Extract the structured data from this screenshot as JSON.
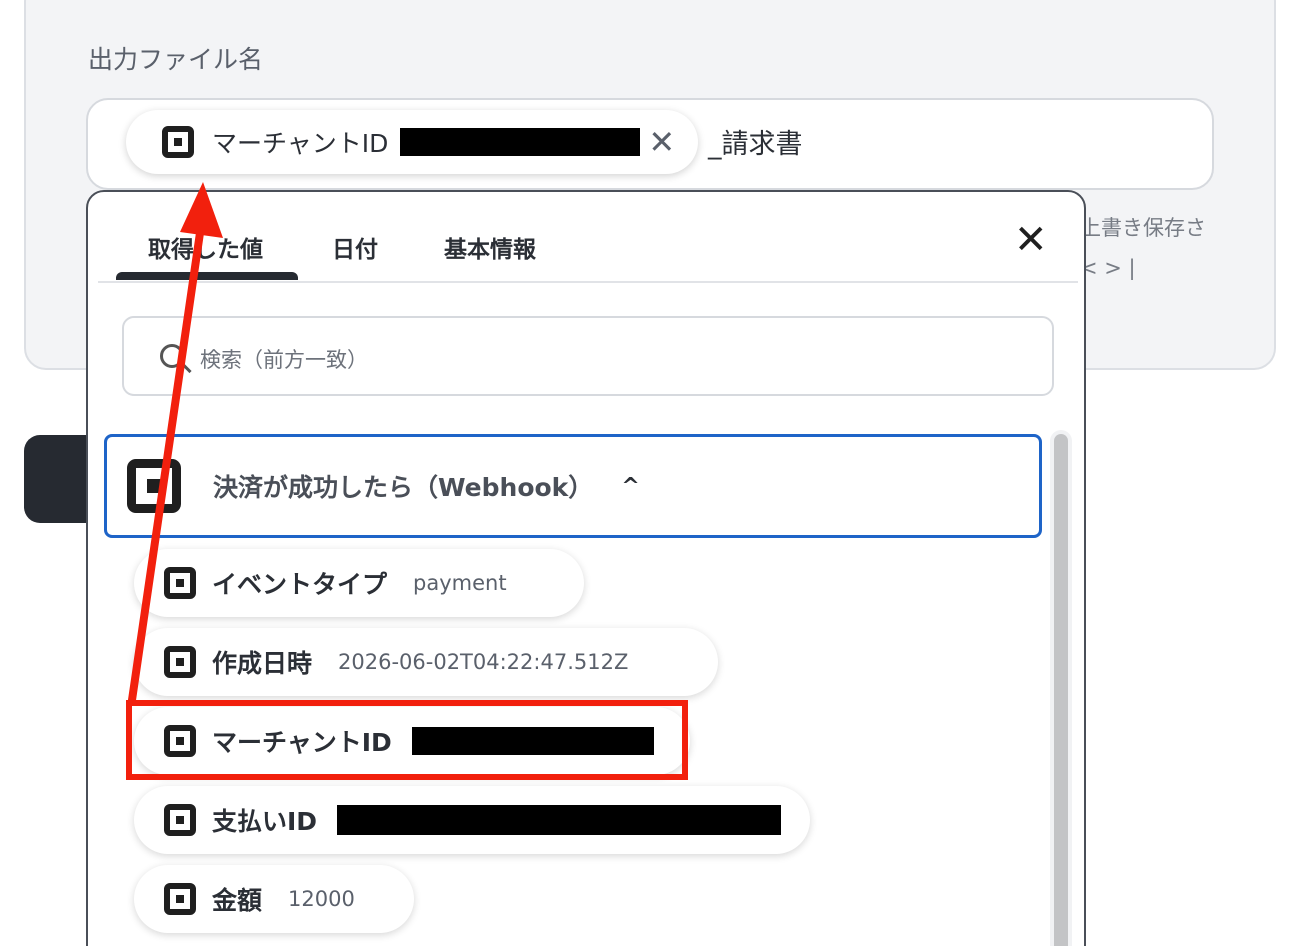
{
  "field": {
    "label": "出力ファイル名",
    "token_label": "マーチャントID",
    "suffix": "_請求書",
    "remove_glyph": "✕"
  },
  "behind": {
    "text1": "上書き保存さ",
    "text2": "< > |"
  },
  "popup": {
    "tabs": [
      "取得した値",
      "日付",
      "基本情報"
    ],
    "active_tab": "取得した値",
    "close_glyph": "✕",
    "search_placeholder": "検索（前方一致）",
    "source": {
      "label": "決済が成功したら（Webhook）",
      "chevron": "^"
    },
    "items": [
      {
        "label": "イベントタイプ",
        "value": "payment"
      },
      {
        "label": "作成日時",
        "value": "2026-06-02T04:22:47.512Z"
      },
      {
        "label": "マーチャントID",
        "value": ""
      },
      {
        "label": "支払いID",
        "value": ""
      },
      {
        "label": "金額",
        "value": "12000"
      }
    ]
  },
  "colors": {
    "highlight": "#f2200d",
    "source_border": "#1e64c8"
  },
  "icons": {
    "app": "square-app-icon",
    "search": "search-icon"
  }
}
